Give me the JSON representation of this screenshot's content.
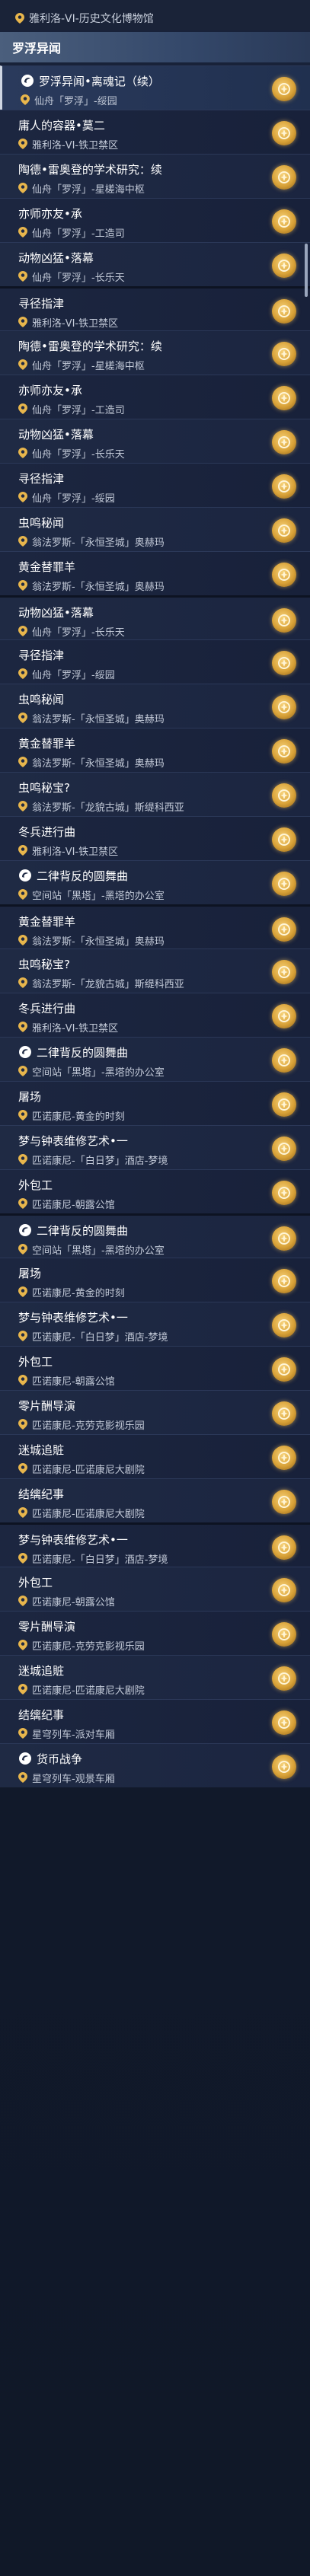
{
  "top_location": "雅利洛-VI-历史文化博物馆",
  "section_title": "罗浮异闻",
  "items": [
    {
      "title": "罗浮异闻•离魂记（续）",
      "location": "仙舟「罗浮」-绥园",
      "icon": "quest-icon",
      "selected": true
    },
    {
      "title": "庸人的容器•莫二",
      "location": "雅利洛-VI-铁卫禁区",
      "icon": ""
    },
    {
      "title": "陶德•雷奥登的学术研究：续",
      "location": "仙舟「罗浮」-星槎海中枢",
      "icon": ""
    },
    {
      "title": "亦师亦友•承",
      "location": "仙舟「罗浮」-工造司",
      "icon": ""
    },
    {
      "title": "动物凶猛•落幕",
      "location": "仙舟「罗浮」-长乐天",
      "icon": ""
    },
    {
      "title": "寻径指津",
      "location": "雅利洛-VI-铁卫禁区",
      "icon": ""
    },
    {
      "title": "陶德•雷奥登的学术研究：续",
      "location": "仙舟「罗浮」-星槎海中枢",
      "icon": ""
    },
    {
      "title": "亦师亦友•承",
      "location": "仙舟「罗浮」-工造司",
      "icon": ""
    },
    {
      "title": "动物凶猛•落幕",
      "location": "仙舟「罗浮」-长乐天",
      "icon": ""
    },
    {
      "title": "寻径指津",
      "location": "仙舟「罗浮」-绥园",
      "icon": ""
    },
    {
      "title": "虫鸣秘闻",
      "location": "翁法罗斯-「永恒圣城」奥赫玛",
      "icon": ""
    },
    {
      "title": "黄金替罪羊",
      "location": "翁法罗斯-「永恒圣城」奥赫玛",
      "icon": ""
    },
    {
      "title": "动物凶猛•落幕",
      "location": "仙舟「罗浮」-长乐天",
      "icon": ""
    },
    {
      "title": "寻径指津",
      "location": "仙舟「罗浮」-绥园",
      "icon": ""
    },
    {
      "title": "虫鸣秘闻",
      "location": "翁法罗斯-「永恒圣城」奥赫玛",
      "icon": ""
    },
    {
      "title": "黄金替罪羊",
      "location": "翁法罗斯-「永恒圣城」奥赫玛",
      "icon": ""
    },
    {
      "title": "虫鸣秘宝?",
      "location": "翁法罗斯-「龙貌古城」斯缇科西亚",
      "icon": ""
    },
    {
      "title": "冬兵进行曲",
      "location": "雅利洛-VI-铁卫禁区",
      "icon": ""
    },
    {
      "title": "二律背反的圆舞曲",
      "location": "空间站「黑塔」-黑塔的办公室",
      "icon": "quest-icon"
    },
    {
      "title": "黄金替罪羊",
      "location": "翁法罗斯-「永恒圣城」奥赫玛",
      "icon": ""
    },
    {
      "title": "虫鸣秘宝?",
      "location": "翁法罗斯-「龙貌古城」斯缇科西亚",
      "icon": ""
    },
    {
      "title": "冬兵进行曲",
      "location": "雅利洛-VI-铁卫禁区",
      "icon": ""
    },
    {
      "title": "二律背反的圆舞曲",
      "location": "空间站「黑塔」-黑塔的办公室",
      "icon": "quest-icon"
    },
    {
      "title": "屠场",
      "location": "匹诺康尼-黄金的时刻",
      "icon": ""
    },
    {
      "title": "梦与钟表维修艺术•一",
      "location": "匹诺康尼-「白日梦」酒店-梦境",
      "icon": ""
    },
    {
      "title": "外包工",
      "location": "匹诺康尼-朝露公馆",
      "icon": ""
    },
    {
      "title": "二律背反的圆舞曲",
      "location": "空间站「黑塔」-黑塔的办公室",
      "icon": "quest-icon"
    },
    {
      "title": "屠场",
      "location": "匹诺康尼-黄金的时刻",
      "icon": ""
    },
    {
      "title": "梦与钟表维修艺术•一",
      "location": "匹诺康尼-「白日梦」酒店-梦境",
      "icon": ""
    },
    {
      "title": "外包工",
      "location": "匹诺康尼-朝露公馆",
      "icon": ""
    },
    {
      "title": "零片酬导演",
      "location": "匹诺康尼-克劳克影视乐园",
      "icon": ""
    },
    {
      "title": "迷城追賍",
      "location": "匹诺康尼-匹诺康尼大剧院",
      "icon": ""
    },
    {
      "title": "结缡纪事",
      "location": "匹诺康尼-匹诺康尼大剧院",
      "icon": ""
    },
    {
      "title": "梦与钟表维修艺术•一",
      "location": "匹诺康尼-「白日梦」酒店-梦境",
      "icon": ""
    },
    {
      "title": "外包工",
      "location": "匹诺康尼-朝露公馆",
      "icon": ""
    },
    {
      "title": "零片酬导演",
      "location": "匹诺康尼-克劳克影视乐园",
      "icon": ""
    },
    {
      "title": "迷城追賍",
      "location": "匹诺康尼-匹诺康尼大剧院",
      "icon": ""
    },
    {
      "title": "结缡纪事",
      "location": "星穹列车-派对车厢",
      "icon": ""
    },
    {
      "title": "货币战争",
      "location": "星穹列车-观景车厢",
      "icon": "quest-icon"
    }
  ],
  "colors": {
    "badge": "#d9a238",
    "pin": "#e8b64c",
    "accent": "#f7d27a"
  }
}
